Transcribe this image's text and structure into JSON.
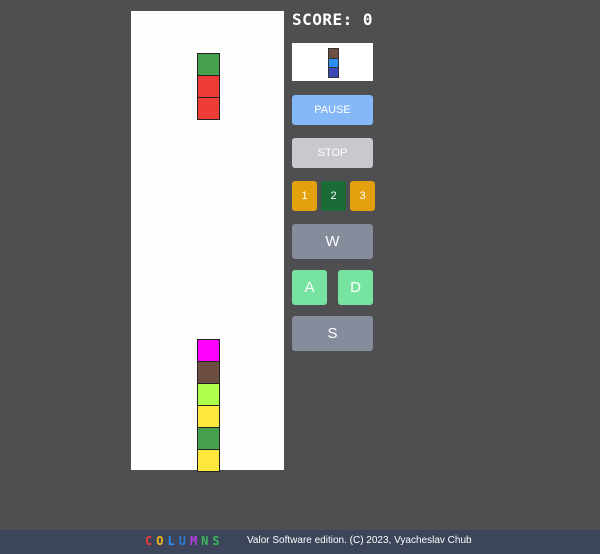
{
  "score": {
    "text": "SCORE: 0"
  },
  "board": {
    "columns": 7,
    "rows": 21,
    "falling_piece": [
      {
        "col": 3,
        "row": 2,
        "color": "#45a14b"
      },
      {
        "col": 3,
        "row": 3,
        "color": "#ef3b35"
      },
      {
        "col": 3,
        "row": 4,
        "color": "#ef3b35"
      }
    ],
    "settled": [
      {
        "col": 3,
        "row": 15,
        "color": "#ff00ff"
      },
      {
        "col": 3,
        "row": 16,
        "color": "#6e4e42"
      },
      {
        "col": 3,
        "row": 17,
        "color": "#adff4a"
      },
      {
        "col": 3,
        "row": 18,
        "color": "#ffe83d"
      },
      {
        "col": 3,
        "row": 19,
        "color": "#45a14b"
      },
      {
        "col": 3,
        "row": 20,
        "color": "#ffe83d"
      }
    ]
  },
  "next_piece": [
    {
      "color": "#6e4e42"
    },
    {
      "color": "#2a8ff0"
    },
    {
      "color": "#3a49b5"
    }
  ],
  "controls": {
    "pause_label": "PAUSE",
    "stop_label": "STOP",
    "levels": [
      {
        "label": "1",
        "selected": false
      },
      {
        "label": "2",
        "selected": true
      },
      {
        "label": "3",
        "selected": false
      }
    ],
    "up_label": "W",
    "left_label": "A",
    "right_label": "D",
    "down_label": "S"
  },
  "footer": {
    "logo_letters": [
      {
        "char": "C",
        "color": "#ef3b35"
      },
      {
        "char": "O",
        "color": "#f0b818"
      },
      {
        "char": "L",
        "color": "#2a8ff0"
      },
      {
        "char": "U",
        "color": "#2c79d8"
      },
      {
        "char": "M",
        "color": "#b43fe0"
      },
      {
        "char": "N",
        "color": "#3ab85a"
      },
      {
        "char": "S",
        "color": "#3ab85a"
      }
    ],
    "copyright": "Valor Software edition. (C) 2023, Vyacheslav Chub"
  }
}
